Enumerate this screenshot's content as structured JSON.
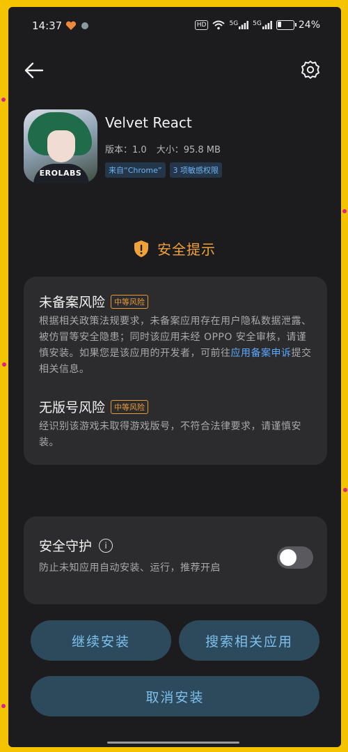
{
  "status_bar": {
    "time": "14:37",
    "hd_label": "HD",
    "network_1": "5G",
    "network_2": "5G",
    "battery_text": "24%",
    "battery_level": 0.24
  },
  "nav": {
    "back_icon": "arrow-left-icon",
    "settings_icon": "gear-icon"
  },
  "app": {
    "name": "Velvet React",
    "icon_brand": "EROLABS",
    "version_label": "版本：1.0",
    "size_label": "大小：95.8 MB",
    "source_tag": "来自“Chrome”",
    "permissions_tag": "3 项敏感权限"
  },
  "security": {
    "title": "安全提示",
    "accent_color": "#f0a23a",
    "risks": [
      {
        "title": "未备案风险",
        "level": "中等风险",
        "description_prefix": "根据相关政策法规要求，未备案应用存在用户隐私数据泄露、被仿冒等安全隐患；同时该应用未经 OPPO 安全审核，请谨慎安装。如果您是该应用的开发者，可前往",
        "link_text": "应用备案申诉",
        "description_suffix": "提交相关信息。"
      },
      {
        "title": "无版号风险",
        "level": "中等风险",
        "description": "经识别该游戏未取得游戏版号，不符合法律要求，请谨慎安装。"
      }
    ]
  },
  "protection": {
    "title": "安全守护",
    "description": "防止未知应用自动安装、运行，推荐开启",
    "enabled": false
  },
  "buttons": {
    "continue_install": "继续安装",
    "search_related": "搜索相关应用",
    "cancel_install": "取消安装"
  }
}
